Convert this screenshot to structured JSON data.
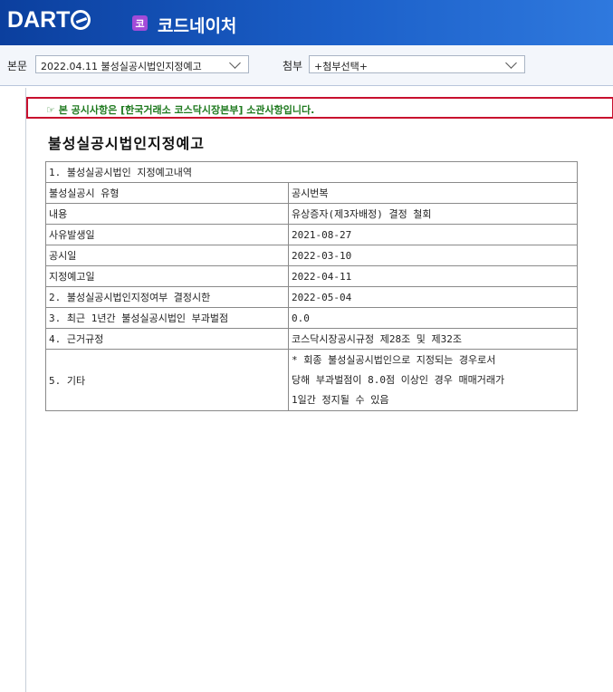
{
  "header": {
    "logo_text": "DART",
    "company_badge": "코",
    "company_name": "코드네이처"
  },
  "toolbar": {
    "body_label": "본문",
    "body_select_value": "2022.04.11  불성실공시법인지정예고",
    "attach_label": "첨부",
    "attach_select_value": "+첨부선택+"
  },
  "notice": {
    "icon": "pointing-hand-icon",
    "text": "본 공시사항은 [한국거래소 코스닥시장본부] 소관사항입니다."
  },
  "document": {
    "title": "불성실공시법인지정예고",
    "section1_header": "1. 불성실공시법인 지정예고내역",
    "rows": [
      {
        "label": "불성실공시 유형",
        "value": "공시번복"
      },
      {
        "label": "내용",
        "value": "유상증자(제3자배정) 결정 철회"
      },
      {
        "label": "사유발생일",
        "value": "2021-08-27"
      },
      {
        "label": "공시일",
        "value": "2022-03-10"
      },
      {
        "label": "지정예고일",
        "value": "2022-04-11"
      },
      {
        "label": "2. 불성실공시법인지정여부 결정시한",
        "value": "2022-05-04"
      },
      {
        "label": "3. 최근 1년간 불성실공시법인 부과벌점",
        "value": "0.0"
      },
      {
        "label": "4. 근거규정",
        "value": "코스닥시장공시규정 제28조 및 제32조"
      }
    ],
    "etc_label": "5. 기타",
    "etc_lines": [
      " * 회종 불성실공시법인으로 지정되는 경우로서",
      "당해 부과벌점이 8.0점 이상인 경우 매매거래가",
      "1일간 정지될 수 있음"
    ]
  },
  "colors": {
    "header_blue": "#1b5fc8",
    "notice_border": "#c8102e",
    "notice_text": "#1f7a1f",
    "badge_purple": "#a24bd8"
  }
}
